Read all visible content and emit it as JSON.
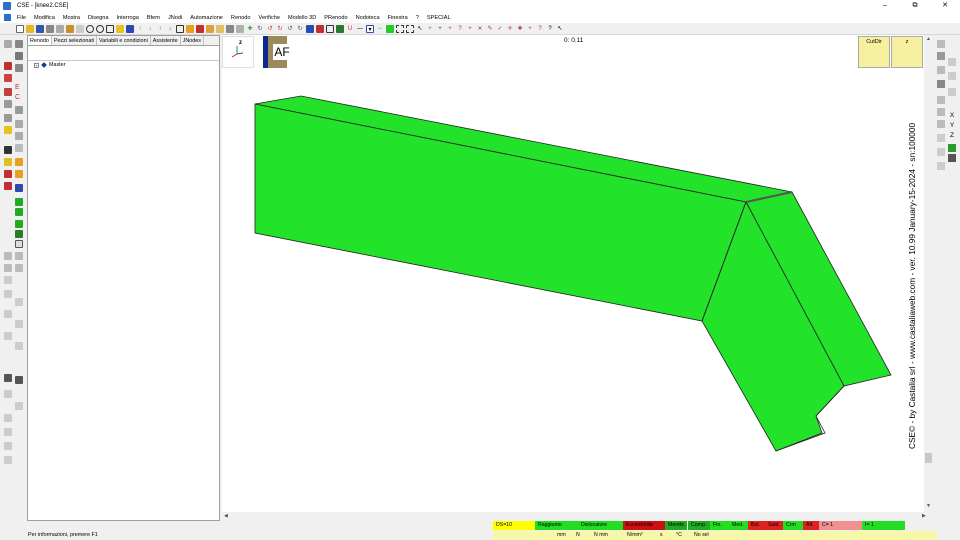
{
  "window": {
    "title": "CSE - [knee2.CSE]",
    "minimize": "–",
    "maximize": "⧉",
    "close": "✕"
  },
  "menu": [
    "File",
    "Modifica",
    "Mostra",
    "Disegna",
    "Interroga",
    "Bfem",
    "JNodi",
    "Automazione",
    "Renodo",
    "Verifiche",
    "Modello 3D",
    "PRenodo",
    "Nodoteca",
    "Finestra",
    "?",
    "SPECIAL"
  ],
  "panel": {
    "tabs": [
      "Renodo",
      "Pezzi selezionati",
      "Variabili e condizioni",
      "Assistente",
      "JNodes"
    ],
    "tree": {
      "expander": "+",
      "label": "Master"
    }
  },
  "viewport": {
    "axis_label": "z",
    "af_label": "AF",
    "timer": "0: 0.11",
    "cut_dir_label": "CutDir",
    "cut_z_label": "z",
    "vertical_text": "CSE© - by Castalia srl - www.castaliaweb.com - ver. 10.99 January-15-2024 - sn:100000",
    "model_color": "#22e22a"
  },
  "right_tools": [
    "X",
    "Y",
    "Z"
  ],
  "status": {
    "info": "Per informazioni, premere F1",
    "cells": [
      {
        "label": "DS=10",
        "color": "#ffff00"
      },
      {
        "label": "Raggiunto",
        "color": "#22dd22"
      },
      {
        "label": "Dislocatore",
        "color": "#22dd22"
      },
      {
        "label": "Eccentricita",
        "color": "#cc1111"
      },
      {
        "label": "Membr.",
        "color": "#22aa22"
      },
      {
        "label": "Comp.",
        "color": "#22aa22"
      },
      {
        "label": "Fin.",
        "color": "#22dd22"
      },
      {
        "label": "Med.",
        "color": "#22dd22"
      },
      {
        "label": "Bol.",
        "color": "#dd2222"
      },
      {
        "label": "Sald.",
        "color": "#dd2222"
      },
      {
        "label": "Crm",
        "color": "#22dd22"
      },
      {
        "label": "Alf.",
        "color": "#dd2222"
      },
      {
        "label": "C=  1",
        "color": "#f09090"
      },
      {
        "label": "I=  1",
        "color": "#22dd22"
      }
    ],
    "units": [
      "mm",
      "N",
      "N mm",
      "N/mm²",
      "s",
      "°C",
      "No sel"
    ]
  }
}
